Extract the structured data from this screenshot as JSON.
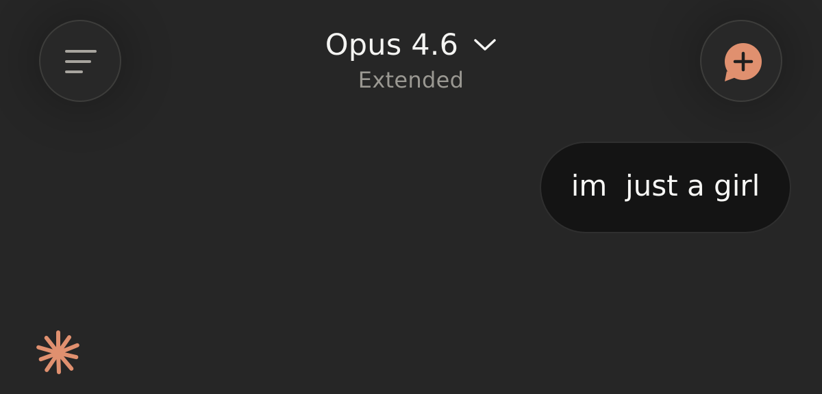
{
  "header": {
    "model_name": "Opus 4.6",
    "mode": "Extended",
    "dropdown_icon": "chevron-down-icon"
  },
  "toolbar": {
    "menu_icon": "menu-icon",
    "new_chat_icon": "new-chat-icon"
  },
  "conversation": {
    "messages": [
      {
        "role": "user",
        "text": "im  just a girl"
      }
    ],
    "assistant_status_icon": "spark-icon"
  },
  "colors": {
    "background": "#262626",
    "accent": "#e0906f",
    "user_bubble": "#141414",
    "primary_text": "#f4f4f2",
    "secondary_text": "#9a9892"
  }
}
